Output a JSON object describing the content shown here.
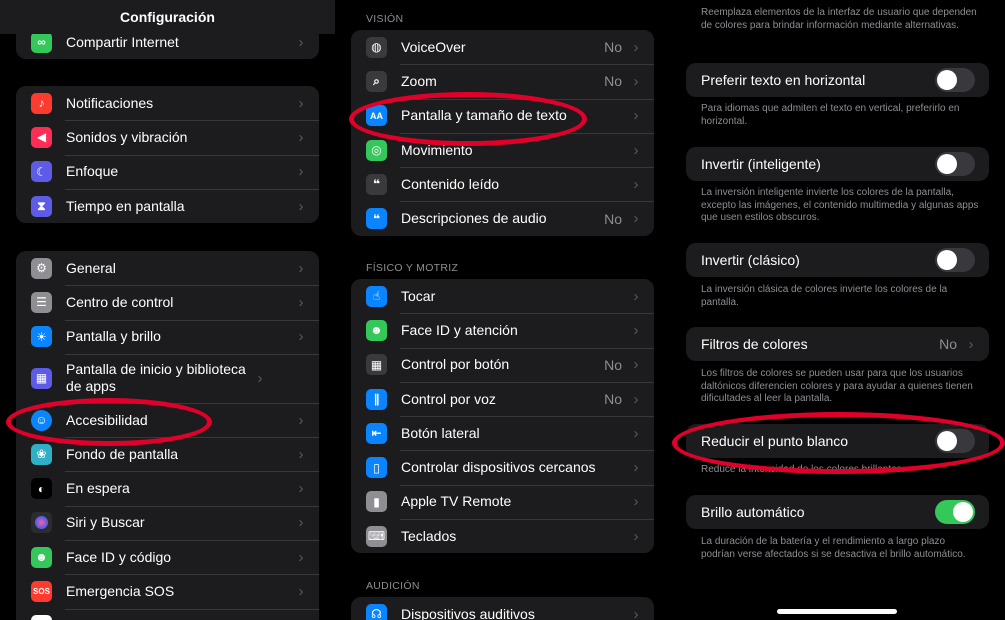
{
  "col1": {
    "nav_title": "Configuración",
    "group0": [
      {
        "label": "Compartir Internet",
        "icon": "personal-hotspot-icon",
        "color": "#34c759",
        "glyph": "∞"
      }
    ],
    "group1": [
      {
        "label": "Notificaciones",
        "icon": "bell-icon",
        "color": "#ff3b30",
        "glyph": "🔔"
      },
      {
        "label": "Sonidos y vibración",
        "icon": "speaker-icon",
        "color": "#ff2d55",
        "glyph": "◀"
      },
      {
        "label": "Enfoque",
        "icon": "moon-icon",
        "color": "#5e5ce6",
        "glyph": "☾"
      },
      {
        "label": "Tiempo en pantalla",
        "icon": "hourglass-icon",
        "color": "#5e5ce6",
        "glyph": "⌛"
      }
    ],
    "group2": [
      {
        "label": "General",
        "icon": "gear-icon",
        "color": "#8e8e93",
        "glyph": "⚙"
      },
      {
        "label": "Centro de control",
        "icon": "toggles-icon",
        "color": "#8e8e93",
        "glyph": "☰"
      },
      {
        "label": "Pantalla y brillo",
        "icon": "sun-icon",
        "color": "#0a84ff",
        "glyph": "☀"
      },
      {
        "label": "Pantalla de inicio y biblioteca de apps",
        "icon": "home-grid-icon",
        "color": "#5e5ce6",
        "glyph": "▦"
      },
      {
        "label": "Accesibilidad",
        "icon": "accessibility-icon",
        "color": "#0a84ff",
        "glyph": "☺"
      },
      {
        "label": "Fondo de pantalla",
        "icon": "flower-icon",
        "color": "#30b0c7",
        "glyph": "❀"
      },
      {
        "label": "En espera",
        "icon": "standby-icon",
        "color": "#1c1c1e",
        "glyph": "◐"
      },
      {
        "label": "Siri y Buscar",
        "icon": "siri-icon",
        "color": "#3a3a3c",
        "glyph": "◉"
      },
      {
        "label": "Face ID y código",
        "icon": "faceid-icon",
        "color": "#34c759",
        "glyph": "☻"
      },
      {
        "label": "Emergencia SOS",
        "icon": "sos-icon",
        "color": "#ff3b30",
        "glyph": "SOS"
      }
    ]
  },
  "col2": {
    "section_vision": "VISIÓN",
    "vision": [
      {
        "label": "VoiceOver",
        "value": "No",
        "icon": "voiceover-icon",
        "color": "#3a3a3c",
        "glyph": "◍"
      },
      {
        "label": "Zoom",
        "value": "No",
        "icon": "zoom-icon",
        "color": "#3a3a3c",
        "glyph": "⌕"
      },
      {
        "label": "Pantalla y tamaño de texto",
        "value": "",
        "icon": "text-size-icon",
        "color": "#0a84ff",
        "glyph": "AA"
      },
      {
        "label": "Movimiento",
        "value": "",
        "icon": "motion-icon",
        "color": "#34c759",
        "glyph": "◎"
      },
      {
        "label": "Contenido leído",
        "value": "",
        "icon": "spoken-content-icon",
        "color": "#3a3a3c",
        "glyph": "💬"
      },
      {
        "label": "Descripciones de audio",
        "value": "No",
        "icon": "audio-description-icon",
        "color": "#0a84ff",
        "glyph": "💬"
      }
    ],
    "section_physical": "FÍSICO Y MOTRIZ",
    "physical": [
      {
        "label": "Tocar",
        "value": "",
        "icon": "touch-icon",
        "color": "#0a84ff",
        "glyph": "☝"
      },
      {
        "label": "Face ID y atención",
        "value": "",
        "icon": "faceid-attention-icon",
        "color": "#34c759",
        "glyph": "☻"
      },
      {
        "label": "Control por botón",
        "value": "No",
        "icon": "switch-control-icon",
        "color": "#3a3a3c",
        "glyph": "▦"
      },
      {
        "label": "Control por voz",
        "value": "No",
        "icon": "voice-control-icon",
        "color": "#0a84ff",
        "glyph": "∥"
      },
      {
        "label": "Botón lateral",
        "value": "",
        "icon": "side-button-icon",
        "color": "#0a84ff",
        "glyph": "⇤"
      },
      {
        "label": "Controlar dispositivos cercanos",
        "value": "",
        "icon": "nearby-devices-icon",
        "color": "#0a84ff",
        "glyph": "▯"
      },
      {
        "label": "Apple TV Remote",
        "value": "",
        "icon": "tv-remote-icon",
        "color": "#8e8e93",
        "glyph": "▮"
      },
      {
        "label": "Teclados",
        "value": "",
        "icon": "keyboard-icon",
        "color": "#8e8e93",
        "glyph": "⌨"
      }
    ],
    "section_hearing": "AUDICIÓN",
    "hearing": [
      {
        "label": "Dispositivos auditivos",
        "value": "",
        "icon": "ear-icon",
        "color": "#0a84ff",
        "glyph": "☊"
      }
    ]
  },
  "col3": {
    "top_note": "Reemplaza elementos de la interfaz de usuario que dependen de colores para brindar información mediante alternativas.",
    "items": [
      {
        "label": "Preferir texto en horizontal",
        "toggle": false,
        "value": "",
        "note": "Para idiomas que admiten el texto en vertical, preferirlo en horizontal."
      },
      {
        "label": "Invertir (inteligente)",
        "toggle": false,
        "value": "",
        "note": "La inversión inteligente invierte los colores de la pantalla, excepto las imágenes, el contenido multimedia y algunas apps que usen estilos obscuros."
      },
      {
        "label": "Invertir (clásico)",
        "toggle": false,
        "value": "",
        "note": "La inversión clásica de colores invierte los colores de la pantalla."
      },
      {
        "label": "Filtros de colores",
        "toggle": null,
        "value": "No",
        "note": "Los filtros de colores se pueden usar para que los usuarios daltónicos diferencien colores y para ayudar a quienes tienen dificultades al leer la pantalla."
      },
      {
        "label": "Reducir el punto blanco",
        "toggle": false,
        "value": "",
        "note": "Reduce la intensidad de los colores brillantes."
      },
      {
        "label": "Brillo automático",
        "toggle": true,
        "value": "",
        "note": "La duración de la batería y el rendimiento a largo plazo podrían verse afectados si se desactiva el brillo automático."
      }
    ]
  },
  "chevron": "›"
}
